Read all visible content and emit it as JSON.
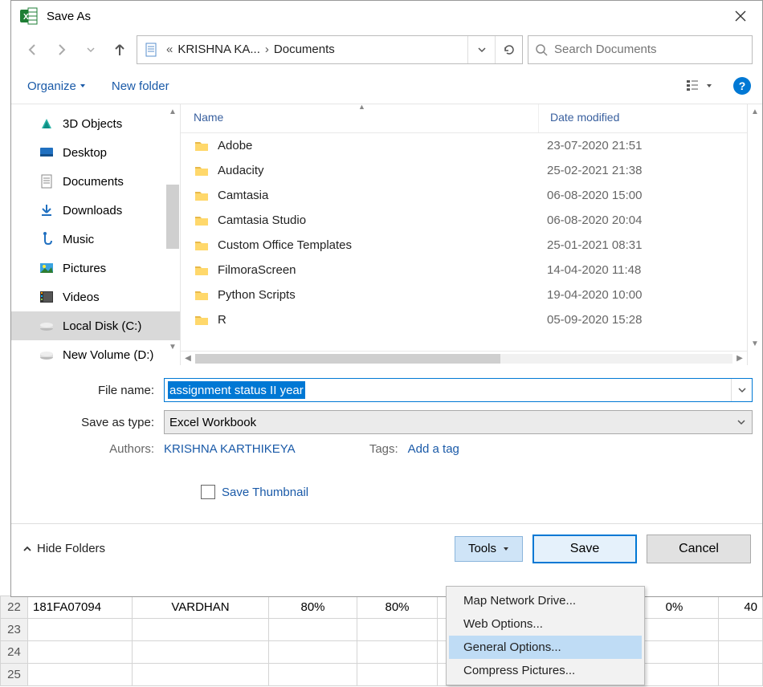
{
  "title": "Save As",
  "breadcrumb": {
    "part1": "KRISHNA KA...",
    "part2": "Documents"
  },
  "search": {
    "placeholder": "Search Documents"
  },
  "toolbar": {
    "organize": "Organize",
    "new_folder": "New folder"
  },
  "sidebar": {
    "items": [
      {
        "label": "3D Objects"
      },
      {
        "label": "Desktop"
      },
      {
        "label": "Documents"
      },
      {
        "label": "Downloads"
      },
      {
        "label": "Music"
      },
      {
        "label": "Pictures"
      },
      {
        "label": "Videos"
      },
      {
        "label": "Local Disk (C:)",
        "selected": true
      },
      {
        "label": "New Volume (D:)"
      }
    ]
  },
  "columns": {
    "name": "Name",
    "date": "Date modified"
  },
  "files": [
    {
      "name": "Adobe",
      "date": "23-07-2020 21:51"
    },
    {
      "name": "Audacity",
      "date": "25-02-2021 21:38"
    },
    {
      "name": "Camtasia",
      "date": "06-08-2020 15:00"
    },
    {
      "name": "Camtasia Studio",
      "date": "06-08-2020 20:04"
    },
    {
      "name": "Custom Office Templates",
      "date": "25-01-2021 08:31"
    },
    {
      "name": "FilmoraScreen",
      "date": "14-04-2020 11:48"
    },
    {
      "name": "Python Scripts",
      "date": "19-04-2020 10:00"
    },
    {
      "name": "R",
      "date": "05-09-2020 15:28"
    }
  ],
  "fields": {
    "file_name_label": "File name:",
    "file_name_value": "assignment status II year",
    "type_label": "Save as type:",
    "type_value": "Excel Workbook",
    "authors_label": "Authors:",
    "authors_value": "KRISHNA KARTHIKEYA",
    "tags_label": "Tags:",
    "tags_hint": "Add a tag",
    "thumbnail_label": "Save Thumbnail"
  },
  "footer": {
    "hide_folders": "Hide Folders",
    "tools": "Tools",
    "save": "Save",
    "cancel": "Cancel"
  },
  "tools_menu": [
    {
      "label": "Map Network Drive..."
    },
    {
      "label": "Web Options..."
    },
    {
      "label": "General Options...",
      "hover": true
    },
    {
      "label": "Compress Pictures..."
    }
  ],
  "sheet": {
    "row1": {
      "num": "22",
      "id": "181FA07094",
      "name": "VARDHAN",
      "c3": "80%",
      "c4": "80%",
      "c5": "",
      "c6": "",
      "c7": "0%",
      "c8": "40"
    },
    "rows": [
      "23",
      "24",
      "25"
    ]
  }
}
